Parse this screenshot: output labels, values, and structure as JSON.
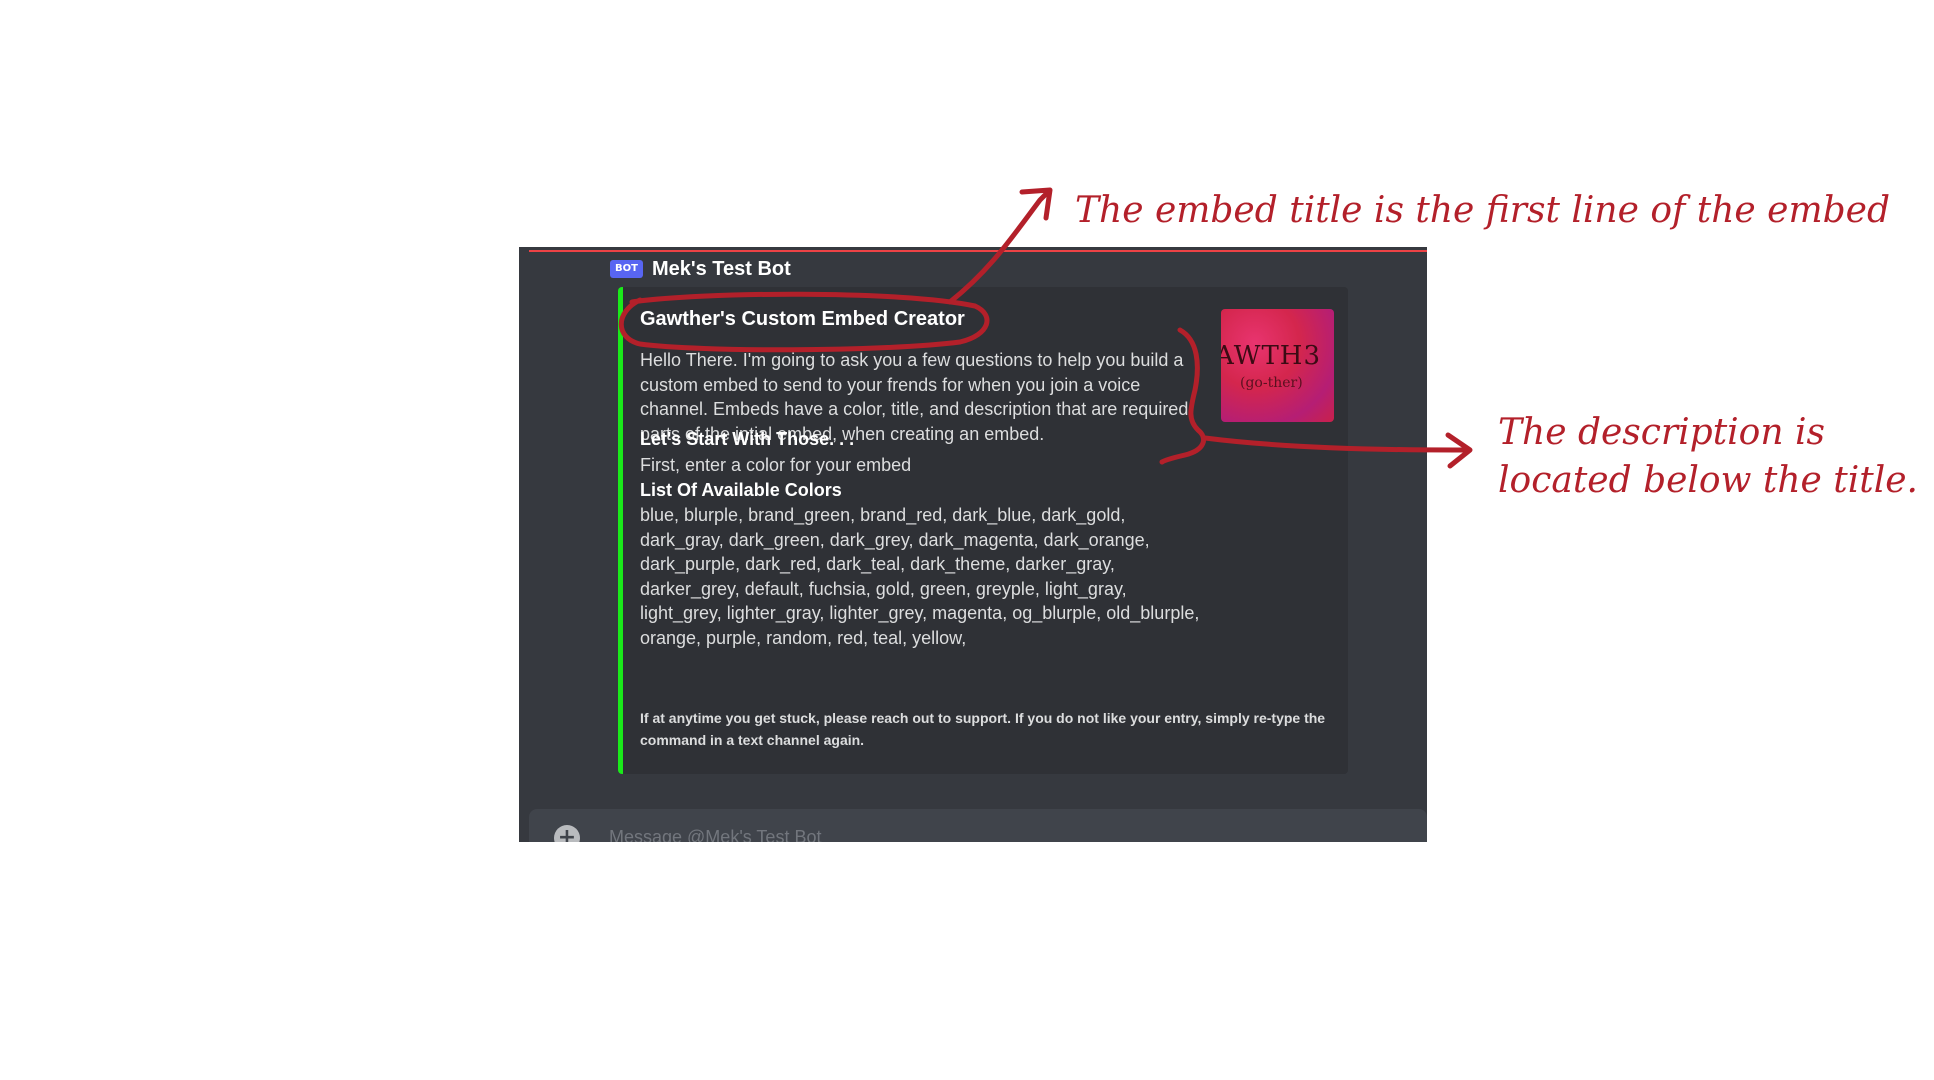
{
  "message": {
    "bot_tag": "BOT",
    "author": "Mek's Test Bot"
  },
  "embed": {
    "accent_color": "#1aea1a",
    "title": "Gawther's Custom Embed Creator",
    "description": "Hello There. I'm going to ask you a few questions to help you build a custom embed to send to your frends for when you join a voice channel. Embeds have a color, title, and description that are required parts of the intial embed, when creating an embed.",
    "fields": [
      {
        "name": "Let's Start With Those. . .",
        "value": "First, enter a color for your embed"
      },
      {
        "name": "List Of Available Colors",
        "value": "blue, blurple, brand_green, brand_red, dark_blue, dark_gold, dark_gray, dark_green, dark_grey, dark_magenta, dark_orange, dark_purple, dark_red, dark_teal, dark_theme, darker_gray, darker_grey, default, fuchsia, gold, green, greyple, light_gray, light_grey, lighter_gray, lighter_grey, magenta, og_blurple, old_blurple, orange, purple, random, red, teal, yellow,"
      }
    ],
    "footer": "If at anytime you get stuck, please reach out to support. If you do not like your entry, simply re-type the command in a text channel again.",
    "thumbnail": {
      "text": "AWTH3",
      "subtext": "(go-ther)"
    }
  },
  "input": {
    "placeholder": "Message @Mek's Test Bot"
  },
  "annotations": {
    "title_note": "The embed title is the first line of the embed",
    "desc_note_line1": "The description is",
    "desc_note_line2": "located below the title."
  },
  "colors": {
    "annotation_red": "#b3202a",
    "discord_bg": "#36393f",
    "embed_bg": "#2f3136",
    "bot_tag": "#5865f2"
  }
}
